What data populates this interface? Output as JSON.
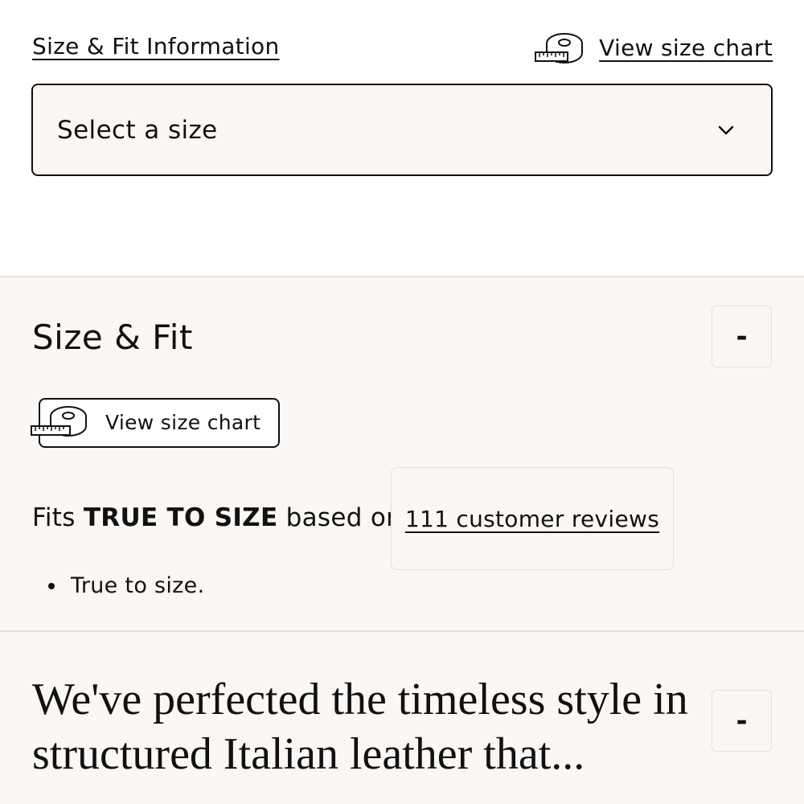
{
  "header": {
    "size_fit_link": "Size & Fit Information",
    "size_chart_link": "View size chart"
  },
  "size_select": {
    "value": "Select a size"
  },
  "size_fit_section": {
    "title": "Size & Fit",
    "toggle_label": "-",
    "chart_button_label": "View size chart",
    "fits_prefix": "Fits",
    "fits_value": "TRUE TO SIZE",
    "fits_suffix": "based on",
    "reviews_link": "111 customer reviews",
    "bullets": [
      "True to size."
    ]
  },
  "description_section": {
    "text": "We've perfected the timeless style in structured Italian leather that...",
    "toggle_label": "-"
  },
  "icons": {
    "tape": "measuring-tape-icon",
    "chevron": "chevron-down-icon"
  }
}
